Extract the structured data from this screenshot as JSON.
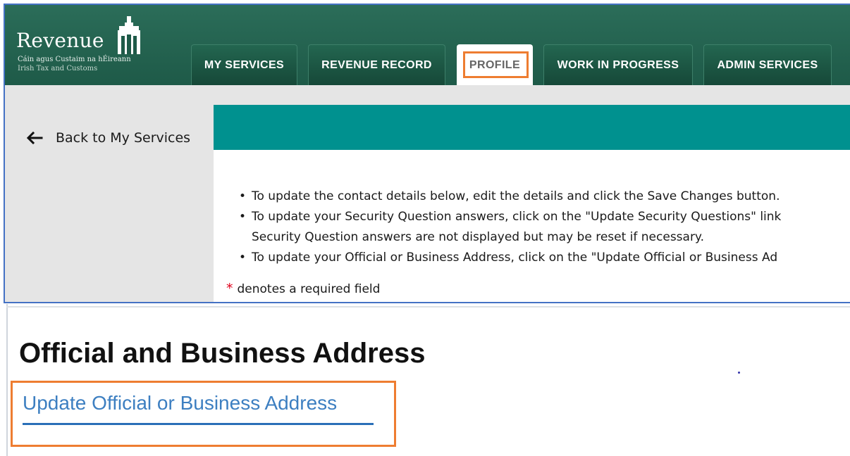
{
  "header": {
    "logo_word": "Revenue",
    "logo_gaelic": "Cáin agus Custaim na hÉireann",
    "logo_english": "Irish Tax and Customs",
    "tabs": [
      {
        "label": "MY SERVICES",
        "active": false
      },
      {
        "label": "REVENUE RECORD",
        "active": false
      },
      {
        "label": "PROFILE",
        "active": true
      },
      {
        "label": "WORK IN PROGRESS",
        "active": false
      },
      {
        "label": "ADMIN SERVICES",
        "active": false
      }
    ]
  },
  "sidebar": {
    "back_label": "Back to My Services",
    "back_icon": "arrow-left-icon"
  },
  "content": {
    "instructions": [
      "To update the contact details below, edit the details and click the Save Changes button.",
      "To update your Security Question answers, click on the \"Update Security Questions\" link",
      "Security Question answers are not displayed but may be reset if necessary.",
      "To update your Official or Business Address, click on the \"Update Official or Business Ad"
    ],
    "required_star": "*",
    "required_note": "denotes a required field"
  },
  "address_section": {
    "title": "Official and Business Address",
    "update_link": "Update Official or Business Address"
  },
  "colors": {
    "header_green": "#1e5a48",
    "teal_bar": "#00918f",
    "highlight_orange": "#ee7d31",
    "link_blue": "#3d7fc1",
    "required_red": "#e0001b"
  }
}
